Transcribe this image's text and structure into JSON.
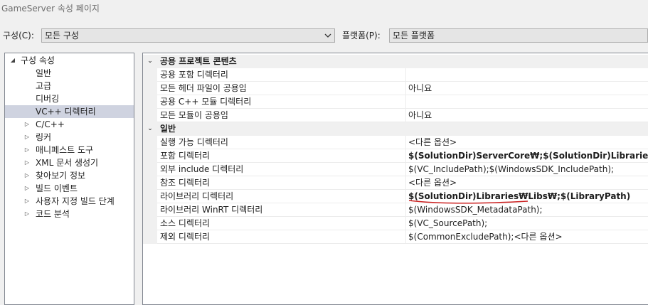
{
  "window": {
    "title": "GameServer 속성 페이지"
  },
  "toolbar": {
    "configuration_label": "구성(C):",
    "configuration_value": "모든 구성",
    "platform_label": "플랫폼(P):",
    "platform_value": "모든 플랫폼"
  },
  "tree": {
    "root_label": "구성 속성",
    "items": [
      {
        "label": "일반",
        "expandable": false,
        "selected": false
      },
      {
        "label": "고급",
        "expandable": false,
        "selected": false
      },
      {
        "label": "디버깅",
        "expandable": false,
        "selected": false
      },
      {
        "label": "VC++ 디렉터리",
        "expandable": false,
        "selected": true
      },
      {
        "label": "C/C++",
        "expandable": true,
        "selected": false
      },
      {
        "label": "링커",
        "expandable": true,
        "selected": false
      },
      {
        "label": "매니페스트 도구",
        "expandable": true,
        "selected": false
      },
      {
        "label": "XML 문서 생성기",
        "expandable": true,
        "selected": false
      },
      {
        "label": "찾아보기 정보",
        "expandable": true,
        "selected": false
      },
      {
        "label": "빌드 이벤트",
        "expandable": true,
        "selected": false
      },
      {
        "label": "사용자 지정 빌드 단계",
        "expandable": true,
        "selected": false
      },
      {
        "label": "코드 분석",
        "expandable": true,
        "selected": false
      }
    ]
  },
  "grid": {
    "categories": [
      {
        "name": "공용 프로젝트 콘텐츠",
        "properties": [
          {
            "name": "공용 포함 디렉터리",
            "value": "",
            "bold": false
          },
          {
            "name": "모든 헤더 파일이 공용임",
            "value": "아니요",
            "bold": false
          },
          {
            "name": "공용 C++ 모듈 디렉터리",
            "value": "",
            "bold": false
          },
          {
            "name": "모든 모듈이 공용임",
            "value": "아니요",
            "bold": false
          }
        ]
      },
      {
        "name": "일반",
        "properties": [
          {
            "name": "실행 가능 디렉터리",
            "value": "<다른 옵션>",
            "bold": false
          },
          {
            "name": "포함 디렉터리",
            "value": "$(SolutionDir)ServerCore₩;$(SolutionDir)Libraries₩Include₩;$(IncludePath)",
            "bold": true
          },
          {
            "name": "외부 include 디렉터리",
            "value": "$(VC_IncludePath);$(WindowsSDK_IncludePath);",
            "bold": false
          },
          {
            "name": "참조 디렉터리",
            "value": "<다른 옵션>",
            "bold": false
          },
          {
            "name": "라이브러리 디렉터리",
            "value": "$(SolutionDir)Libraries₩Libs₩;$(LibraryPath)",
            "bold": true
          },
          {
            "name": "라이브러리 WinRT 디렉터리",
            "value": "$(WindowsSDK_MetadataPath);",
            "bold": false
          },
          {
            "name": "소스 디렉터리",
            "value": "$(VC_SourcePath);",
            "bold": false
          },
          {
            "name": "제외 디렉터리",
            "value": "$(CommonExcludePath);<다른 옵션>",
            "bold": false
          }
        ]
      }
    ]
  },
  "annotation": {
    "underline_color": "#cc2222"
  },
  "icons": {
    "tree_expanded": "triangle-down-right-icon",
    "tree_collapsed": "triangle-right-icon",
    "category_expanded": "chevron-down-icon",
    "dropdown": "chevron-down-icon"
  }
}
